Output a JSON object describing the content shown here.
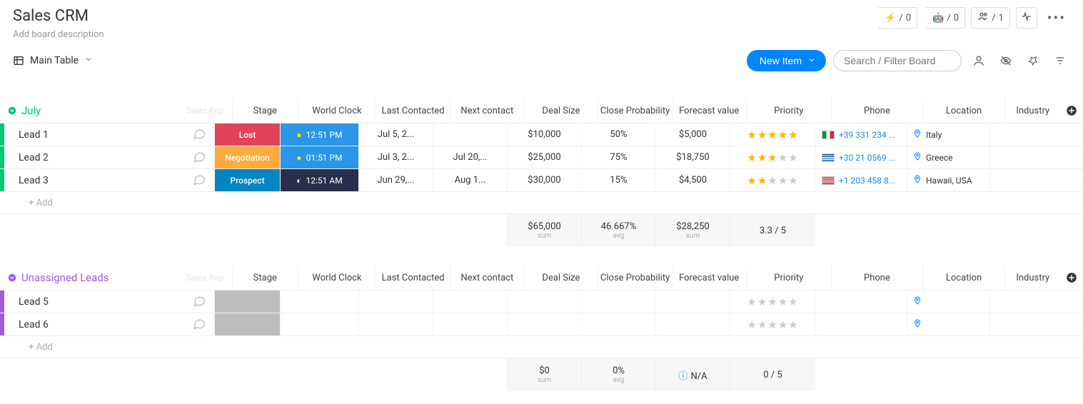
{
  "header": {
    "title": "Sales CRM",
    "description": "Add board description",
    "badges": {
      "a": "0",
      "b": "0",
      "people": "1"
    }
  },
  "toolbar": {
    "view_label": "Main Table",
    "new_item_label": "New Item",
    "search_placeholder": "Search / Filter Board"
  },
  "columns": [
    "Stage",
    "World Clock",
    "Last Contacted",
    "Next contact",
    "Deal Size",
    "Close Probability",
    "Forecast value",
    "Priority",
    "Phone",
    "Location",
    "Industry"
  ],
  "groups": [
    {
      "id": "july",
      "title": "July",
      "color": "#00c875",
      "sales_rep_ghost": "Sales Rep",
      "rows": [
        {
          "name": "Lead 1",
          "stage": {
            "label": "Lost",
            "bg": "#e2445c"
          },
          "clock": {
            "label": "12:51 PM",
            "bg": "#2996ea",
            "icon": "sun"
          },
          "last": "Jul 5, 2...",
          "next": "",
          "deal": "$10,000",
          "prob": "50%",
          "fore": "$5,000",
          "stars": 5,
          "phone": {
            "num": "+39 331 234 ...",
            "flag": "it"
          },
          "loc": "Italy"
        },
        {
          "name": "Lead 2",
          "stage": {
            "label": "Negotiation",
            "bg": "#fdab3d"
          },
          "clock": {
            "label": "01:51 PM",
            "bg": "#2996ea",
            "icon": "sun"
          },
          "last": "Jul 3, 2...",
          "next": "Jul 20,...",
          "deal": "$25,000",
          "prob": "75%",
          "fore": "$18,750",
          "stars": 3,
          "phone": {
            "num": "+30 21 0569 ...",
            "flag": "gr"
          },
          "loc": "Greece"
        },
        {
          "name": "Lead 3",
          "stage": {
            "label": "Prospect",
            "bg": "#0086c0"
          },
          "clock": {
            "label": "12:51 AM",
            "bg": "#2b2e4a",
            "icon": "moon"
          },
          "last": "Jun 29,...",
          "next": "Aug 1...",
          "deal": "$30,000",
          "prob": "15%",
          "fore": "$4,500",
          "stars": 2,
          "phone": {
            "num": "+1 203 458 8...",
            "flag": "us"
          },
          "loc": "Hawaii, USA"
        }
      ],
      "add_label": "+ Add",
      "summary": {
        "deal": "$65,000",
        "deal_sub": "sum",
        "prob": "46.667%",
        "prob_sub": "avg",
        "fore": "$28,250",
        "fore_sub": "sum",
        "prio": "3.3 / 5"
      }
    },
    {
      "id": "unassigned",
      "title": "Unassigned Leads",
      "color": "#a25ddc",
      "sales_rep_ghost": "Sales Rep",
      "rows": [
        {
          "name": "Lead 5",
          "empty": true,
          "stars": 0
        },
        {
          "name": "Lead 6",
          "empty": true,
          "stars": 0
        }
      ],
      "add_label": "+ Add",
      "summary": {
        "deal": "$0",
        "deal_sub": "sum",
        "prob": "0%",
        "prob_sub": "avg",
        "fore": "N/A",
        "fore_na": true,
        "prio": "0 / 5"
      }
    }
  ]
}
